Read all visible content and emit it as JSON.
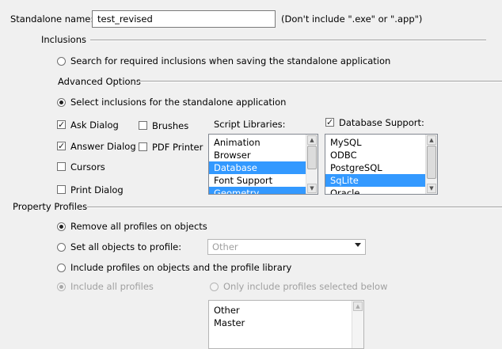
{
  "standalone": {
    "name_label": "Standalone name:",
    "name_value": "test_revised",
    "hint": "(Don't include \".exe\" or \".app\")"
  },
  "inclusions": {
    "group_label": "Inclusions",
    "search_option": "Search for required inclusions when saving the standalone application",
    "advanced_label": "Advanced Options",
    "select_option": "Select inclusions for the standalone application",
    "checkboxes": {
      "ask_dialog": "Ask Dialog",
      "answer_dialog": "Answer Dialog",
      "cursors": "Cursors",
      "print_dialog": "Print Dialog",
      "brushes": "Brushes",
      "pdf_printer": "PDF Printer"
    },
    "script_libraries": {
      "label": "Script Libraries:",
      "items": [
        "Animation",
        "Browser",
        "Database",
        "Font Support",
        "Geometry"
      ],
      "selected": "Database"
    },
    "database_support": {
      "label": "Database Support:",
      "items": [
        "MySQL",
        "ODBC",
        "PostgreSQL",
        "SqLite",
        "Oracle"
      ],
      "selected": "SqLite"
    }
  },
  "property_profiles": {
    "group_label": "Property Profiles",
    "remove_option": "Remove all profiles on objects",
    "set_option": "Set all objects to profile:",
    "set_select_value": "Other",
    "include_option": "Include profiles on objects and the profile library",
    "include_all": "Include all profiles",
    "only_selected": "Only include profiles selected below",
    "profiles": [
      "Other",
      "Master"
    ]
  }
}
